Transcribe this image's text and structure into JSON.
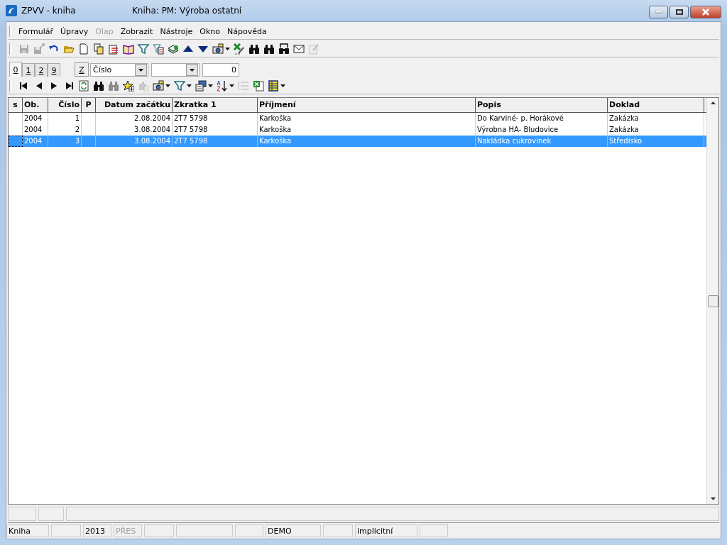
{
  "window": {
    "title": "ZPVV - kniha",
    "subtitle": "Kniha: PM: Výroba ostatní"
  },
  "menu": [
    {
      "label": "Formulář",
      "disabled": false
    },
    {
      "label": "Úpravy",
      "disabled": false
    },
    {
      "label": "Olap",
      "disabled": true
    },
    {
      "label": "Zobrazit",
      "disabled": false
    },
    {
      "label": "Nástroje",
      "disabled": false
    },
    {
      "label": "Okno",
      "disabled": false
    },
    {
      "label": "Nápověda",
      "disabled": false
    }
  ],
  "toolbar": [
    {
      "disabled": true
    },
    {
      "disabled": true
    },
    {
      "disabled": false
    },
    {
      "disabled": false
    },
    {
      "disabled": false
    },
    {
      "disabled": false
    },
    {
      "disabled": false
    },
    {
      "disabled": false
    },
    {
      "disabled": false
    },
    {
      "disabled": false
    },
    {
      "disabled": false
    },
    {
      "disabled": false
    },
    {
      "disabled": false
    },
    {
      "disabled": false
    },
    {
      "disabled": false
    },
    {
      "disabled": false
    },
    {
      "disabled": false
    },
    {
      "disabled": false
    },
    {
      "disabled": false
    },
    {
      "disabled": true
    }
  ],
  "tabs": [
    {
      "label": "0",
      "selected": true
    },
    {
      "label": "1",
      "selected": false
    },
    {
      "label": "2",
      "selected": false
    },
    {
      "label": "9",
      "selected": false
    }
  ],
  "filter": {
    "button": "Z",
    "field_combo": "Číslo",
    "value": "0"
  },
  "nav_toolbar": [
    {
      "disabled": false
    },
    {
      "disabled": false
    },
    {
      "disabled": false
    },
    {
      "disabled": false
    },
    {
      "disabled": false
    },
    {
      "disabled": false
    },
    {
      "disabled": true
    },
    {
      "disabled": false
    },
    {
      "disabled": true
    },
    {
      "disabled": false
    },
    {
      "disabled": false
    },
    {
      "disabled": false
    },
    {
      "disabled": false
    },
    {
      "disabled": true
    },
    {
      "disabled": false
    },
    {
      "disabled": false
    }
  ],
  "table": {
    "columns": [
      {
        "label": "s"
      },
      {
        "label": "Ob."
      },
      {
        "label": "Číslo"
      },
      {
        "label": "P"
      },
      {
        "label": "Datum začátku"
      },
      {
        "label": "Zkratka 1"
      },
      {
        "label": "Příjmení"
      },
      {
        "label": "Popis"
      },
      {
        "label": "Doklad"
      }
    ],
    "rows": [
      {
        "selected": false,
        "cells": [
          "",
          "2004",
          "1",
          "",
          "2.08.2004",
          "2T7 5798",
          "Karkoška",
          "Do Karviné- p. Horákové",
          "Zakázka"
        ]
      },
      {
        "selected": false,
        "cells": [
          "",
          "2004",
          "2",
          "",
          "3.08.2004",
          "2T7 5798",
          "Karkoška",
          "Výrobna HA- Bludovice",
          "Zakázka"
        ]
      },
      {
        "selected": true,
        "cells": [
          "",
          "2004",
          "3",
          "",
          "3.08.2004",
          "2T7 5798",
          "Karkoška",
          "Nakládka cukrovinek",
          "Středisko"
        ]
      }
    ]
  },
  "status_bar": [
    {
      "text": "Kniha",
      "disabled": false
    },
    {
      "text": "2013",
      "disabled": false
    },
    {
      "text": "PŘES",
      "disabled": true
    },
    {
      "text": "DEMO",
      "disabled": false
    },
    {
      "text": "implicitní",
      "disabled": false
    }
  ]
}
